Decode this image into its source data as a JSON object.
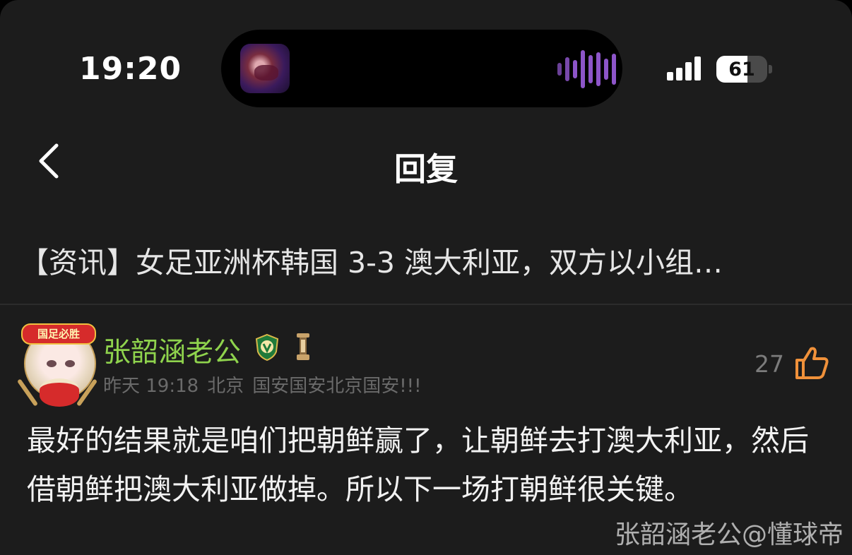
{
  "status_bar": {
    "time": "19:20",
    "battery": "61",
    "battery_level": 0.61,
    "signal_bars": 4
  },
  "nav": {
    "back_icon": "chevron-left-icon",
    "title": "回复"
  },
  "news": {
    "title": "【资讯】女足亚洲杯韩国 3-3 澳大利亚，双方以小组…"
  },
  "comment": {
    "avatar_banner": "国足必胜",
    "username": "张韶涵老公",
    "username_color": "#8fd34d",
    "badges": [
      "guoan-club-badge-icon",
      "level-badge-icon"
    ],
    "time": "昨天 19:18",
    "location": "北京",
    "signature": "国安国安北京国安!!!",
    "likes": "27",
    "like_icon_color": "#f0913a",
    "content": "最好的结果就是咱们把朝鲜赢了，让朝鲜去打澳大利亚，然后借朝鲜把澳大利亚做掉。所以下一场打朝鲜很关键。"
  },
  "watermark": "张韶涵老公@懂球帝"
}
